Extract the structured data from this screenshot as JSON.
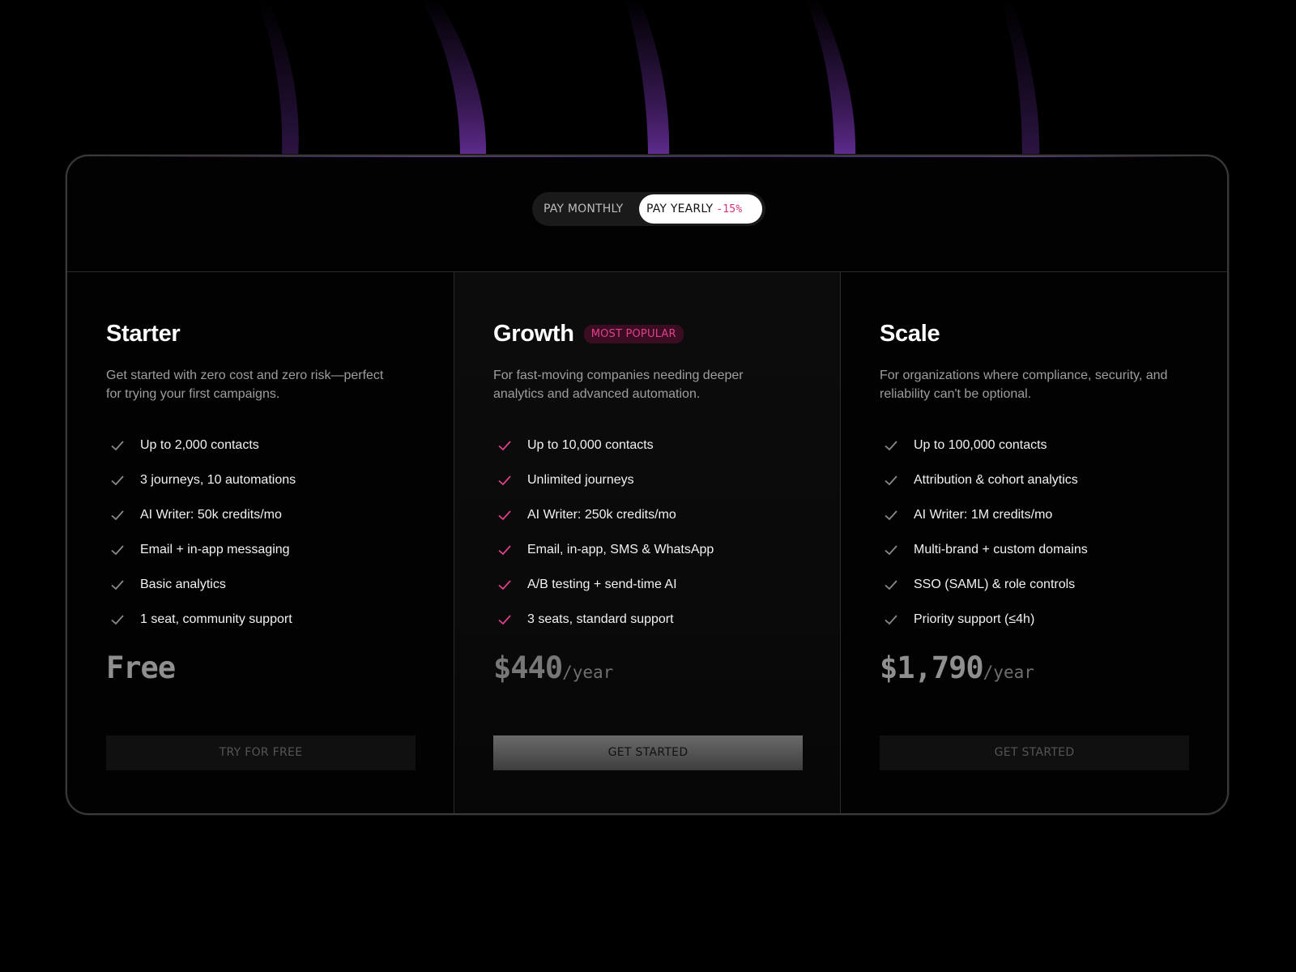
{
  "billing_toggle": {
    "monthly_label": "PAY MONTHLY",
    "yearly_label": "PAY YEARLY",
    "yearly_discount": "-15%",
    "selected": "yearly"
  },
  "colors": {
    "accent_pink": "#e0408a",
    "check_default": "#8a8a8a",
    "background": "#000000"
  },
  "plans": [
    {
      "name": "Starter",
      "badge": "",
      "description": "Get started with zero cost and zero risk—perfect for trying your first campaigns.",
      "features": [
        "Up to 2,000 contacts",
        "3 journeys, 10 automations",
        "AI Writer: 50k credits/mo",
        "Email + in-app messaging",
        "Basic analytics",
        "1 seat, community support"
      ],
      "price": "Free",
      "period": "",
      "cta_label": "TRY FOR FREE",
      "check_icon": "check-icon"
    },
    {
      "name": "Growth",
      "badge": "MOST POPULAR",
      "description": "For fast-moving companies needing deeper analytics and advanced automation.",
      "features": [
        "Up to 10,000 contacts",
        "Unlimited journeys",
        "AI Writer: 250k credits/mo",
        "Email, in-app, SMS & WhatsApp",
        "A/B testing + send-time AI",
        "3 seats, standard support"
      ],
      "price": "$440",
      "period": "/year",
      "cta_label": "GET STARTED",
      "check_icon": "check-icon"
    },
    {
      "name": "Scale",
      "badge": "",
      "description": "For organizations where compliance, security, and reliability can't be optional.",
      "features": [
        "Up to 100,000 contacts",
        "Attribution & cohort analytics",
        "AI Writer: 1M credits/mo",
        "Multi-brand + custom domains",
        "SSO (SAML) & role controls",
        "Priority support (≤4h)"
      ],
      "price": "$1,790",
      "period": "/year",
      "cta_label": "GET STARTED",
      "check_icon": "check-icon"
    }
  ]
}
